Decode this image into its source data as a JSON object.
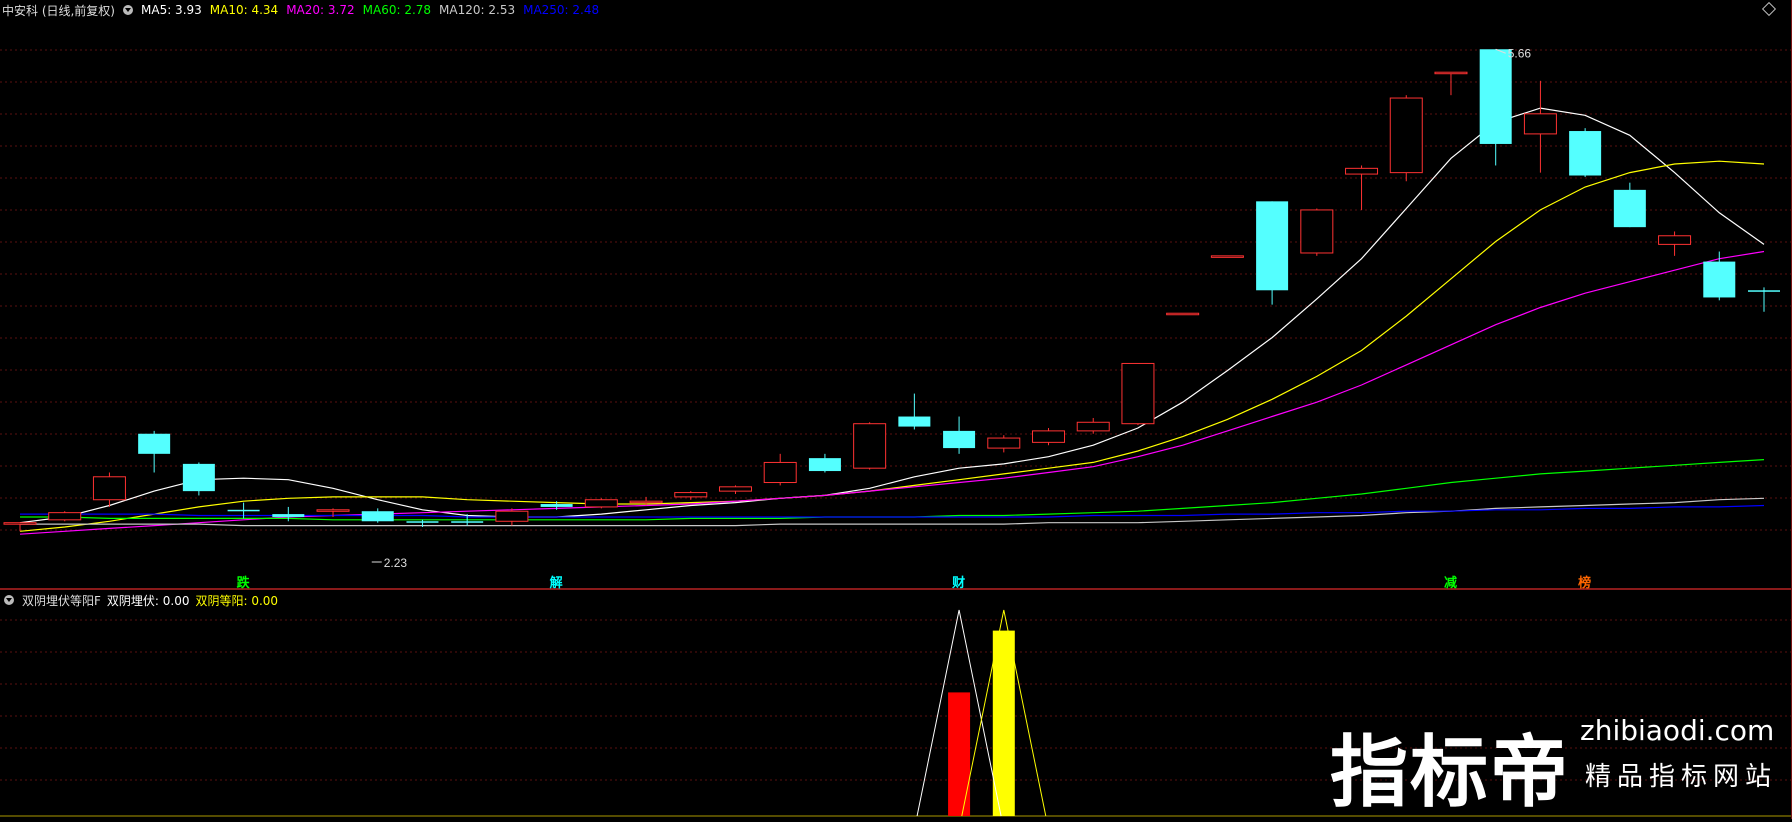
{
  "main_legend": {
    "stock": "中安科 (日线,前复权)",
    "items": [
      {
        "label": "MA5: 3.93",
        "color": "#ffffff"
      },
      {
        "label": "MA10: 4.34",
        "color": "#ffff00"
      },
      {
        "label": "MA20: 3.72",
        "color": "#ff00ff"
      },
      {
        "label": "MA60: 2.78",
        "color": "#00ff00"
      },
      {
        "label": "MA120: 2.53",
        "color": "#c8c8c8"
      },
      {
        "label": "MA250: 2.48",
        "color": "#0000ff"
      }
    ]
  },
  "sub_legend": {
    "indicator": "双阴埋伏等阳F",
    "items": [
      {
        "label": "双阴埋伏: 0.00",
        "color": "#ffffff"
      },
      {
        "label": "双阴等阳: 0.00",
        "color": "#ffff00"
      }
    ]
  },
  "annotations": {
    "high_label": "5.66",
    "low_label": "2.23"
  },
  "events": [
    {
      "text": "跌",
      "color": "#00ff00"
    },
    {
      "text": "解",
      "color": "#00ffff"
    },
    {
      "text": "财",
      "color": "#00ffff"
    },
    {
      "text": "减",
      "color": "#00ff00"
    },
    {
      "text": "榜",
      "color": "#ff6600"
    }
  ],
  "watermark": {
    "brand": "指标帝",
    "url": "zhibiaodi.com",
    "slogan": "精品指标网站"
  },
  "chart_data": {
    "type": "candlestick",
    "price_range": [
      2.1,
      5.85
    ],
    "candles": [
      {
        "o": 2.35,
        "c": 2.36,
        "h": 2.36,
        "l": 2.3,
        "up": true
      },
      {
        "o": 2.38,
        "c": 2.43,
        "h": 2.44,
        "l": 2.37,
        "up": true
      },
      {
        "o": 2.52,
        "c": 2.68,
        "h": 2.71,
        "l": 2.47,
        "up": true
      },
      {
        "o": 2.98,
        "c": 2.84,
        "h": 3.0,
        "l": 2.71,
        "up": false
      },
      {
        "o": 2.77,
        "c": 2.58,
        "h": 2.78,
        "l": 2.55,
        "up": false
      },
      {
        "o": 2.44,
        "c": 2.45,
        "h": 2.5,
        "l": 2.39,
        "up": false
      },
      {
        "o": 2.42,
        "c": 2.4,
        "h": 2.47,
        "l": 2.37,
        "up": false
      },
      {
        "o": 2.44,
        "c": 2.45,
        "h": 2.46,
        "l": 2.4,
        "up": true
      },
      {
        "o": 2.44,
        "c": 2.37,
        "h": 2.46,
        "l": 2.36,
        "up": false
      },
      {
        "o": 2.36,
        "c": 2.37,
        "h": 2.38,
        "l": 2.33,
        "up": false
      },
      {
        "o": 2.37,
        "c": 2.37,
        "h": 2.42,
        "l": 2.34,
        "up": false
      },
      {
        "o": 2.37,
        "c": 2.44,
        "h": 2.46,
        "l": 2.34,
        "up": true
      },
      {
        "o": 2.49,
        "c": 2.47,
        "h": 2.51,
        "l": 2.45,
        "up": false
      },
      {
        "o": 2.47,
        "c": 2.52,
        "h": 2.53,
        "l": 2.46,
        "up": true
      },
      {
        "o": 2.51,
        "c": 2.51,
        "h": 2.54,
        "l": 2.48,
        "up": true
      },
      {
        "o": 2.54,
        "c": 2.57,
        "h": 2.58,
        "l": 2.52,
        "up": true
      },
      {
        "o": 2.58,
        "c": 2.61,
        "h": 2.62,
        "l": 2.56,
        "up": true
      },
      {
        "o": 2.64,
        "c": 2.78,
        "h": 2.84,
        "l": 2.62,
        "up": true
      },
      {
        "o": 2.81,
        "c": 2.72,
        "h": 2.84,
        "l": 2.71,
        "up": false
      },
      {
        "o": 2.74,
        "c": 3.05,
        "h": 3.06,
        "l": 2.73,
        "up": true
      },
      {
        "o": 3.1,
        "c": 3.03,
        "h": 3.26,
        "l": 3.01,
        "up": false
      },
      {
        "o": 3.0,
        "c": 2.88,
        "h": 3.1,
        "l": 2.84,
        "up": false
      },
      {
        "o": 2.88,
        "c": 2.95,
        "h": 2.97,
        "l": 2.85,
        "up": true
      },
      {
        "o": 2.92,
        "c": 3.0,
        "h": 3.02,
        "l": 2.9,
        "up": true
      },
      {
        "o": 3.0,
        "c": 3.06,
        "h": 3.09,
        "l": 2.98,
        "up": true
      },
      {
        "o": 3.05,
        "c": 3.47,
        "h": 3.47,
        "l": 3.04,
        "up": true
      },
      {
        "o": 3.82,
        "c": 3.82,
        "h": 3.82,
        "l": 3.82,
        "up": true
      },
      {
        "o": 4.22,
        "c": 4.22,
        "h": 4.22,
        "l": 4.22,
        "up": true
      },
      {
        "o": 4.6,
        "c": 3.98,
        "h": 4.6,
        "l": 3.88,
        "up": false
      },
      {
        "o": 4.24,
        "c": 4.54,
        "h": 4.55,
        "l": 4.22,
        "up": true
      },
      {
        "o": 4.79,
        "c": 4.83,
        "h": 4.85,
        "l": 4.54,
        "up": true
      },
      {
        "o": 4.8,
        "c": 5.32,
        "h": 5.34,
        "l": 4.74,
        "up": true
      },
      {
        "o": 5.5,
        "c": 5.5,
        "h": 5.5,
        "l": 5.34,
        "up": true
      },
      {
        "o": 5.66,
        "c": 5.0,
        "h": 5.66,
        "l": 4.85,
        "up": false
      },
      {
        "o": 5.07,
        "c": 5.21,
        "h": 5.44,
        "l": 4.8,
        "up": true
      },
      {
        "o": 5.09,
        "c": 4.78,
        "h": 5.11,
        "l": 4.77,
        "up": false
      },
      {
        "o": 4.68,
        "c": 4.42,
        "h": 4.73,
        "l": 4.42,
        "up": false
      },
      {
        "o": 4.3,
        "c": 4.36,
        "h": 4.39,
        "l": 4.22,
        "up": true
      },
      {
        "o": 4.18,
        "c": 3.93,
        "h": 4.25,
        "l": 3.91,
        "up": false
      },
      {
        "o": 3.98,
        "c": 3.98,
        "h": 4.0,
        "l": 3.83,
        "up": false
      }
    ],
    "ma_series": [
      {
        "name": "MA5",
        "color": "#ffffff",
        "values": [
          2.36,
          2.4,
          2.48,
          2.58,
          2.66,
          2.67,
          2.66,
          2.6,
          2.52,
          2.45,
          2.41,
          2.4,
          2.4,
          2.42,
          2.45,
          2.48,
          2.5,
          2.53,
          2.55,
          2.6,
          2.68,
          2.74,
          2.77,
          2.82,
          2.9,
          3.02,
          3.2,
          3.42,
          3.65,
          3.92,
          4.2,
          4.55,
          4.9,
          5.15,
          5.25,
          5.2,
          5.06,
          4.8,
          4.52,
          4.3
        ]
      },
      {
        "name": "MA10",
        "color": "#ffff00",
        "values": [
          2.3,
          2.33,
          2.37,
          2.42,
          2.47,
          2.51,
          2.53,
          2.54,
          2.54,
          2.54,
          2.52,
          2.51,
          2.5,
          2.49,
          2.49,
          2.5,
          2.51,
          2.53,
          2.55,
          2.58,
          2.62,
          2.66,
          2.7,
          2.74,
          2.78,
          2.86,
          2.96,
          3.08,
          3.22,
          3.38,
          3.56,
          3.8,
          4.06,
          4.32,
          4.54,
          4.7,
          4.8,
          4.86,
          4.88,
          4.86
        ]
      },
      {
        "name": "MA20",
        "color": "#ff00ff",
        "values": [
          2.28,
          2.3,
          2.32,
          2.34,
          2.36,
          2.38,
          2.4,
          2.41,
          2.42,
          2.43,
          2.44,
          2.45,
          2.46,
          2.47,
          2.48,
          2.49,
          2.51,
          2.53,
          2.55,
          2.58,
          2.61,
          2.64,
          2.67,
          2.71,
          2.75,
          2.82,
          2.9,
          3.0,
          3.1,
          3.2,
          3.32,
          3.46,
          3.6,
          3.74,
          3.86,
          3.96,
          4.04,
          4.12,
          4.2,
          4.25
        ]
      },
      {
        "name": "MA60",
        "color": "#00ff00",
        "values": [
          2.4,
          2.4,
          2.39,
          2.39,
          2.39,
          2.39,
          2.39,
          2.38,
          2.38,
          2.38,
          2.38,
          2.38,
          2.38,
          2.38,
          2.38,
          2.39,
          2.39,
          2.39,
          2.4,
          2.4,
          2.4,
          2.41,
          2.41,
          2.42,
          2.43,
          2.44,
          2.46,
          2.48,
          2.5,
          2.53,
          2.56,
          2.6,
          2.64,
          2.67,
          2.7,
          2.72,
          2.74,
          2.76,
          2.78,
          2.8
        ]
      },
      {
        "name": "MA120",
        "color": "#c8c8c8",
        "values": [
          2.35,
          2.35,
          2.35,
          2.35,
          2.35,
          2.34,
          2.34,
          2.34,
          2.34,
          2.34,
          2.34,
          2.34,
          2.34,
          2.34,
          2.34,
          2.34,
          2.34,
          2.35,
          2.35,
          2.35,
          2.35,
          2.35,
          2.35,
          2.36,
          2.36,
          2.36,
          2.37,
          2.38,
          2.39,
          2.4,
          2.41,
          2.43,
          2.44,
          2.46,
          2.47,
          2.48,
          2.49,
          2.5,
          2.52,
          2.53
        ]
      },
      {
        "name": "MA250",
        "color": "#0000ff",
        "values": [
          2.42,
          2.42,
          2.42,
          2.42,
          2.41,
          2.41,
          2.41,
          2.41,
          2.41,
          2.41,
          2.4,
          2.4,
          2.4,
          2.4,
          2.4,
          2.4,
          2.4,
          2.4,
          2.4,
          2.4,
          2.4,
          2.4,
          2.4,
          2.4,
          2.41,
          2.41,
          2.41,
          2.42,
          2.42,
          2.43,
          2.43,
          2.44,
          2.44,
          2.45,
          2.45,
          2.46,
          2.46,
          2.47,
          2.47,
          2.48
        ]
      }
    ],
    "indicator_bars": [
      {
        "index": 21,
        "value": 0.6,
        "color": "#ff0000"
      },
      {
        "index": 22,
        "value": 0.9,
        "color": "#ffff00"
      }
    ],
    "indicator_lines": [
      {
        "name": "双阴埋伏",
        "color": "#ffffff",
        "peak_index": 21,
        "peak": 1.0
      },
      {
        "name": "双阴等阳",
        "color": "#ffff00",
        "peak_index": 22,
        "peak": 1.0
      }
    ]
  }
}
